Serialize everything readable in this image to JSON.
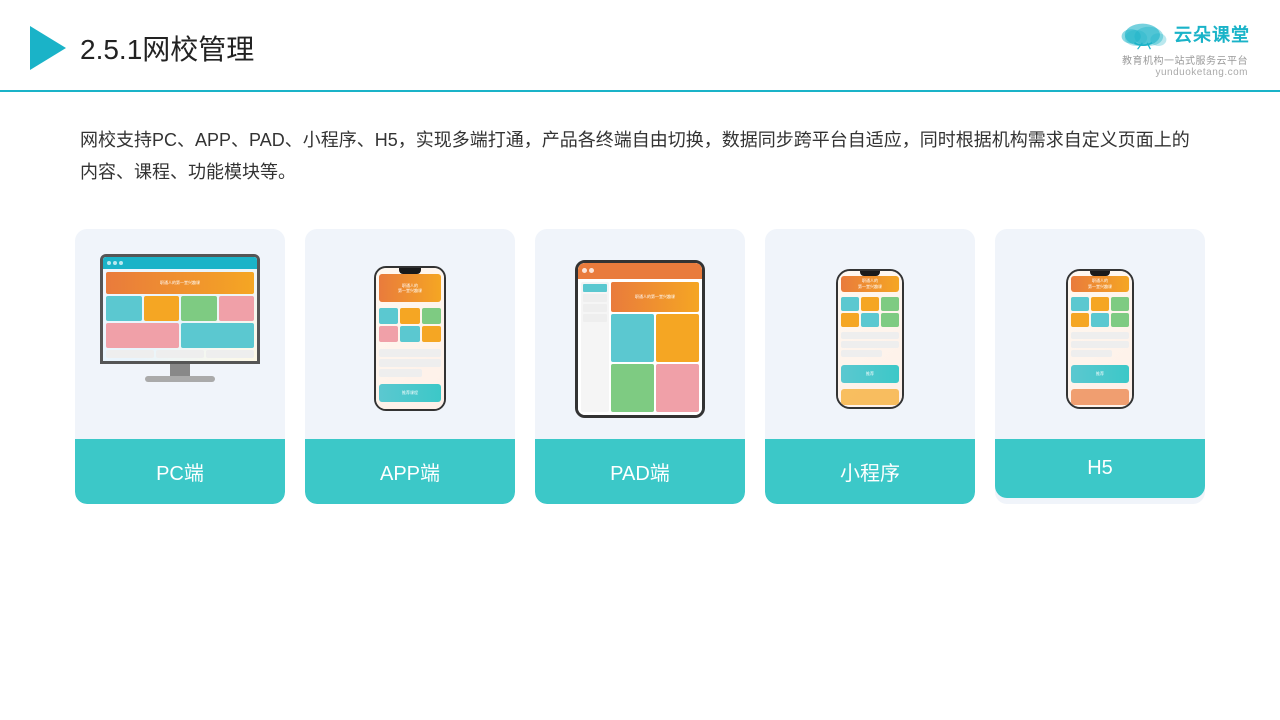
{
  "header": {
    "title_number": "2.5.1",
    "title_text": "网校管理",
    "logo_name": "云朵课堂",
    "logo_url": "yunduoketang.com",
    "logo_tagline": "教育机构一站式服务云平台"
  },
  "description": {
    "text": "网校支持PC、APP、PAD、小程序、H5，实现多端打通，产品各终端自由切换，数据同步跨平台自适应，同时根据机构需求自定义页面上的内容、课程、功能模块等。"
  },
  "cards": [
    {
      "id": "pc",
      "label": "PC端"
    },
    {
      "id": "app",
      "label": "APP端"
    },
    {
      "id": "pad",
      "label": "PAD端"
    },
    {
      "id": "miniapp",
      "label": "小程序"
    },
    {
      "id": "h5",
      "label": "H5"
    }
  ],
  "colors": {
    "teal": "#3cc8c8",
    "accent": "#1ab3c8",
    "card_bg": "#f0f4fa"
  }
}
